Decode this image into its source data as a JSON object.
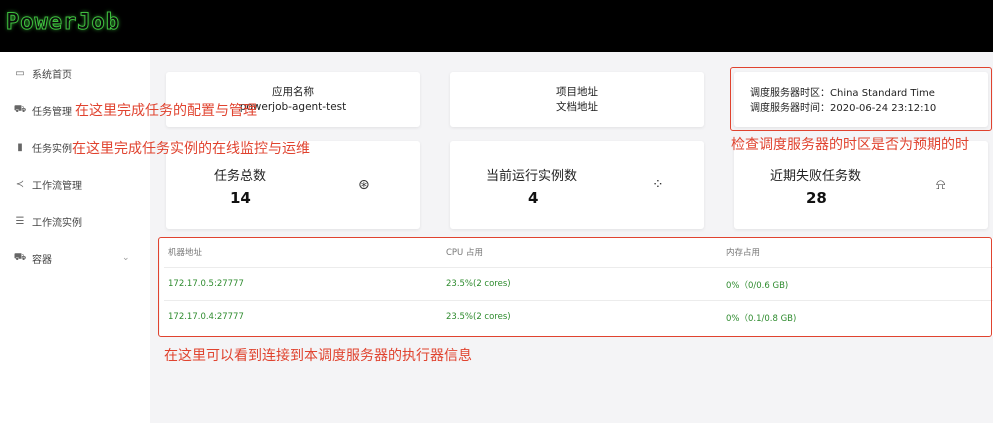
{
  "app": {
    "logo": "PowerJob"
  },
  "sidebar": {
    "items": [
      {
        "label": "系统首页",
        "icon": "monitor-icon"
      },
      {
        "label": "任务管理",
        "icon": "cart-icon"
      },
      {
        "label": "任务实例",
        "icon": "bar-chart-icon"
      },
      {
        "label": "工作流管理",
        "icon": "share-icon"
      },
      {
        "label": "工作流实例",
        "icon": "list-icon"
      },
      {
        "label": "容器",
        "icon": "container-icon",
        "chevron": "⌄"
      }
    ]
  },
  "info": {
    "app_name_label": "应用名称",
    "app_name_value": "powerjob-agent-test",
    "project_label": "项目地址",
    "docs_label": "文档地址",
    "timezone_line": "调度服务器时区：China Standard Time",
    "time_line": "调度服务器时间：2020-06-24 23:12:10"
  },
  "stats": {
    "total_title": "任务总数",
    "total_value": "14",
    "running_title": "当前运行实例数",
    "running_value": "4",
    "failed_title": "近期失败任务数",
    "failed_value": "28"
  },
  "workers": {
    "headers": [
      "机器地址",
      "CPU 占用",
      "内存占用"
    ],
    "rows": [
      [
        "172.17.0.5:27777",
        "23.5%(2 cores)",
        "0%（0/0.6 GB)"
      ],
      [
        "172.17.0.4:27777",
        "23.5%(2 cores)",
        "0%（0.1/0.8 GB)"
      ]
    ]
  },
  "annotations": {
    "task_mgmt": "在这里完成任务的配置与管理",
    "task_instance": "在这里完成任务实例的在线监控与运维",
    "timezone_check": "检查调度服务器的时区是否为预期的时",
    "worker_info": "在这里可以看到连接到本调度服务器的执行器信息"
  },
  "colors": {
    "annotation": "#e0432f",
    "accent_green": "#2e8b2e",
    "topbar": "#000000"
  }
}
